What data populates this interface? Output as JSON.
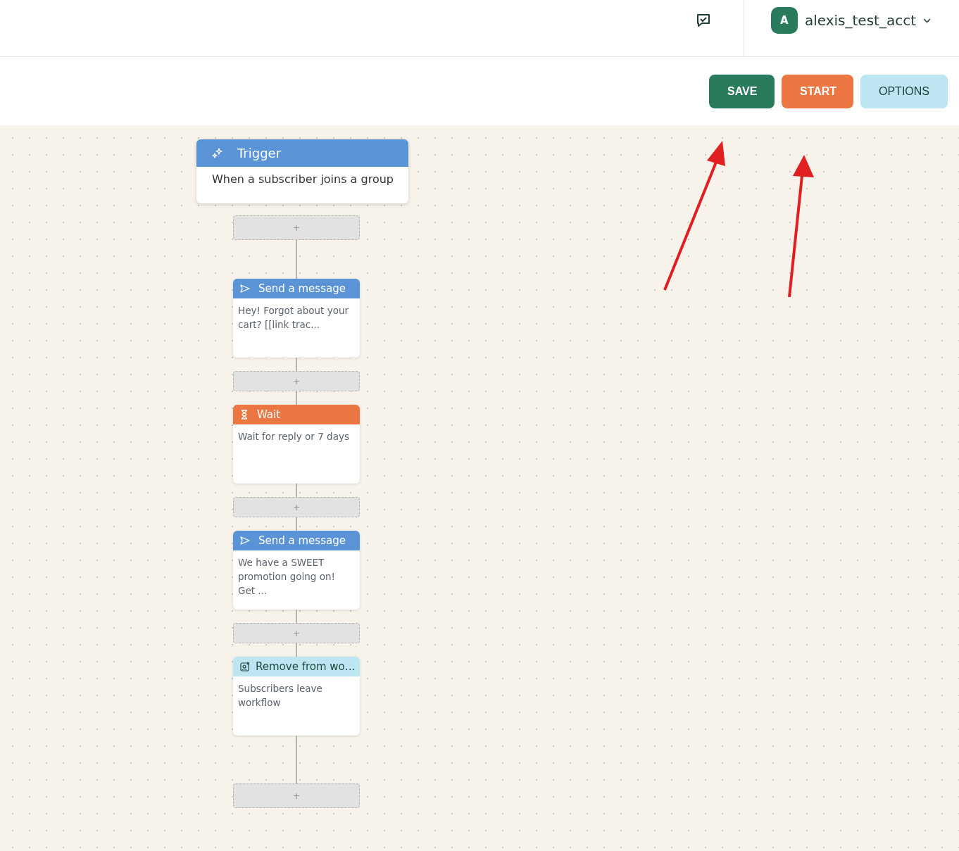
{
  "header": {
    "avatar_letter": "A",
    "account_name": "alexis_test_acct"
  },
  "toolbar": {
    "buttons": [
      {
        "label": "SAVE",
        "kind": "save"
      },
      {
        "label": "START",
        "kind": "start"
      },
      {
        "label": "OPTIONS",
        "kind": "options"
      }
    ]
  },
  "trigger": {
    "title": "Trigger",
    "description": "When a subscriber joins a group"
  },
  "add_slot_label": "+",
  "steps": [
    {
      "kind": "message",
      "title": "Send a message",
      "description": "Hey! Forgot about your cart? [[link trac..."
    },
    {
      "kind": "wait",
      "title": "Wait",
      "description": "Wait for reply or 7 days"
    },
    {
      "kind": "message",
      "title": "Send a message",
      "description": "We have a SWEET promotion going on! Get ..."
    },
    {
      "kind": "remove",
      "title": "Remove from wo…",
      "description": "Subscribers leave workflow"
    }
  ]
}
